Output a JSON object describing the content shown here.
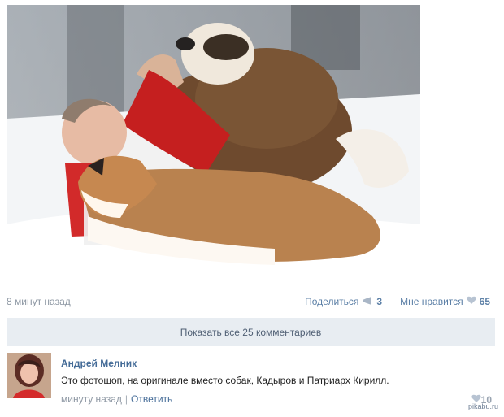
{
  "post": {
    "image_alt": "person lying in snow with two dogs",
    "time": "8 минут назад",
    "share_label": "Поделиться",
    "share_count": "3",
    "like_label": "Мне нравится",
    "like_count": "65",
    "show_all_comments": "Показать все 25 комментариев"
  },
  "comment": {
    "author": "Андрей Мелник",
    "text": "Это фотошоп, на оригинале вместо собак, Кадыров и Патриарх Кирилл.",
    "time": "минуту назад",
    "separator": "|",
    "reply_label": "Ответить",
    "likes": "10"
  },
  "watermark": "pikabu.ru",
  "icons": {
    "share": "megaphone-icon",
    "like": "heart-icon",
    "comment_like": "heart-icon"
  },
  "colors": {
    "link": "#5b7fa6",
    "author": "#456c98",
    "show_all_bg": "#e8edf2",
    "meta": "#8d97a3"
  }
}
